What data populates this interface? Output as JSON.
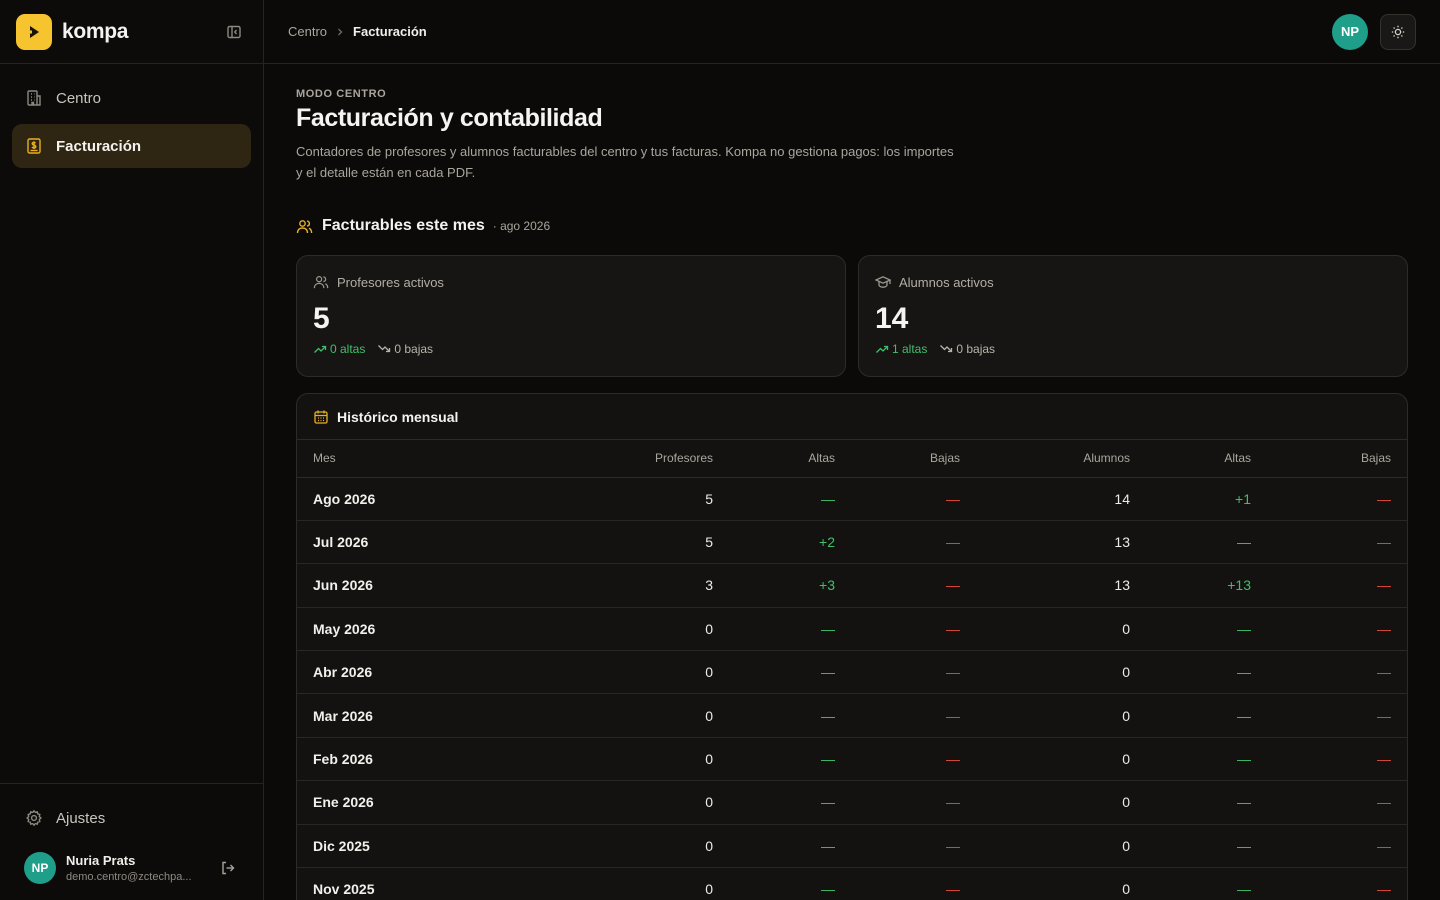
{
  "brand": {
    "name": "kompa"
  },
  "sidebar": {
    "items": [
      {
        "label": "Centro",
        "icon": "building-icon"
      },
      {
        "label": "Facturación",
        "icon": "receipt-icon"
      }
    ],
    "settings_label": "Ajustes",
    "user": {
      "initials": "NP",
      "name": "Nuria Prats",
      "email": "demo.centro@zctechpa..."
    }
  },
  "breadcrumb": {
    "parent": "Centro",
    "current": "Facturación"
  },
  "topbar": {
    "avatar_initials": "NP"
  },
  "page": {
    "eyebrow": "MODO CENTRO",
    "title": "Facturación y contabilidad",
    "description": "Contadores de profesores y alumnos facturables del centro y tus facturas. Kompa no gestiona pagos: los importes y el detalle están en cada PDF."
  },
  "section": {
    "title": "Facturables este mes",
    "subtitle": "· ago 2026"
  },
  "cards": [
    {
      "label": "Profesores activos",
      "value": "5",
      "altas": "0 altas",
      "bajas": "0 bajas"
    },
    {
      "label": "Alumnos activos",
      "value": "14",
      "altas": "1 altas",
      "bajas": "0 bajas"
    }
  ],
  "history": {
    "title": "Histórico mensual",
    "columns": [
      "Mes",
      "Profesores",
      "Altas",
      "Bajas",
      "Alumnos",
      "Altas",
      "Bajas"
    ],
    "rows": [
      [
        "Ago 2026",
        "5",
        "—",
        "—",
        "14",
        "+1",
        "—"
      ],
      [
        "Jul 2026",
        "5",
        "+2",
        "—",
        "13",
        "—",
        "—"
      ],
      [
        "Jun 2026",
        "3",
        "+3",
        "—",
        "13",
        "+13",
        "—"
      ],
      [
        "May 2026",
        "0",
        "—",
        "—",
        "0",
        "—",
        "—"
      ],
      [
        "Abr 2026",
        "0",
        "—",
        "—",
        "0",
        "—",
        "—"
      ],
      [
        "Mar 2026",
        "0",
        "—",
        "—",
        "0",
        "—",
        "—"
      ],
      [
        "Feb 2026",
        "0",
        "—",
        "—",
        "0",
        "—",
        "—"
      ],
      [
        "Ene 2026",
        "0",
        "—",
        "—",
        "0",
        "—",
        "—"
      ],
      [
        "Dic 2025",
        "0",
        "—",
        "—",
        "0",
        "—",
        "—"
      ],
      [
        "Nov 2025",
        "0",
        "—",
        "—",
        "0",
        "—",
        "—"
      ]
    ]
  },
  "colors": {
    "accent": "#f6c42e",
    "positive": "#3fbf6a",
    "negative": "#e04a3c",
    "avatar": "#1f9e8a"
  }
}
